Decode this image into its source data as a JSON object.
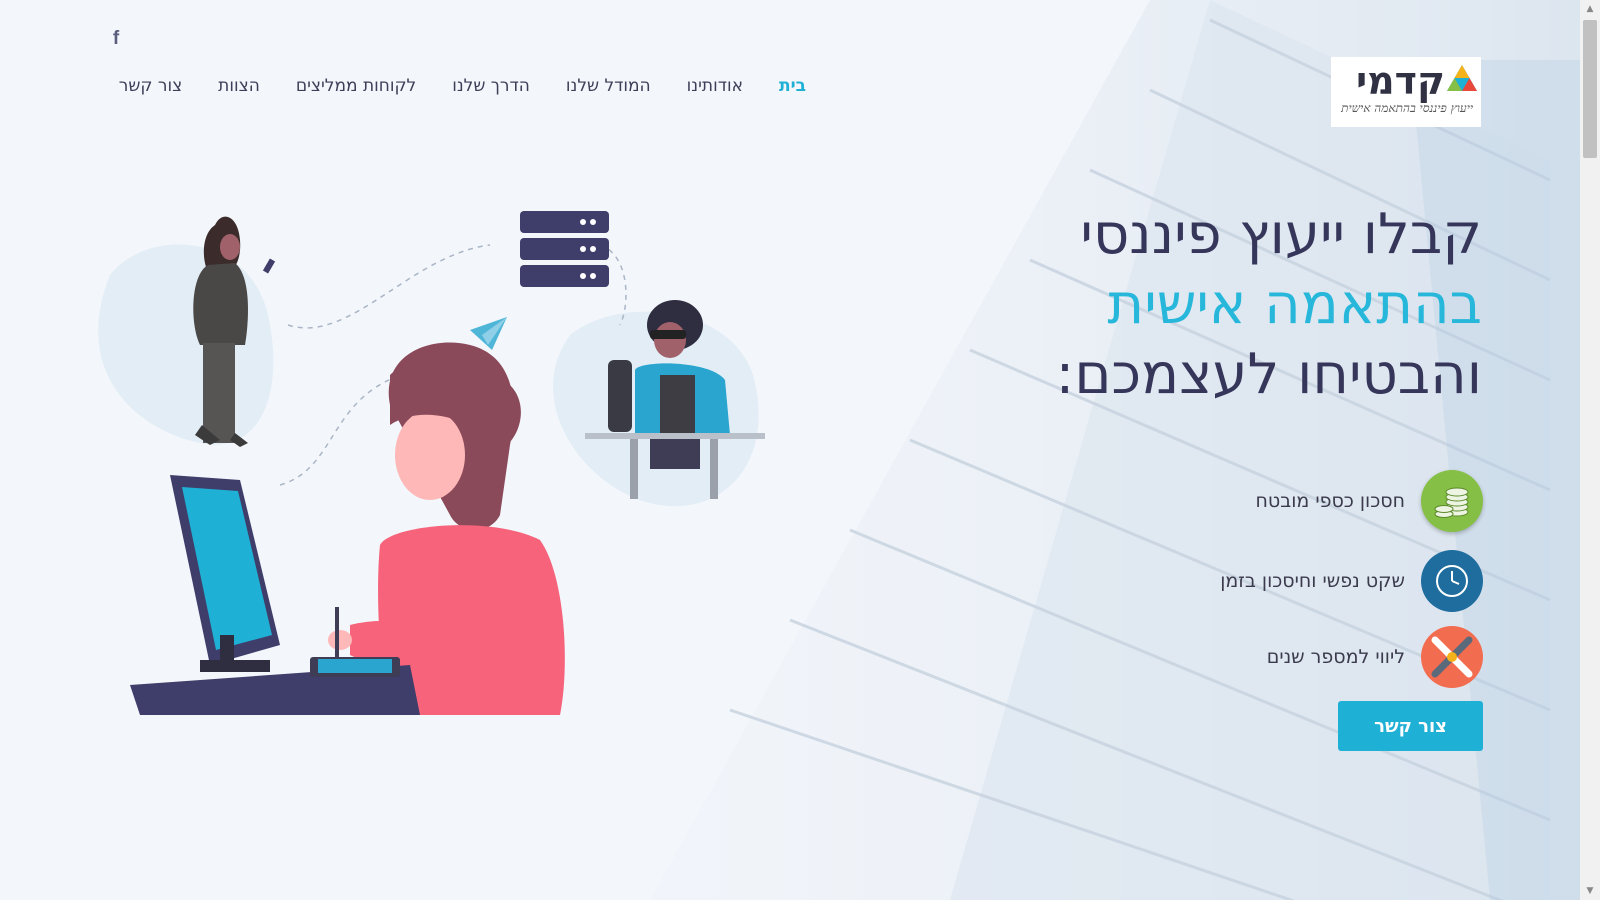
{
  "social": {
    "facebook_icon": "facebook-icon",
    "facebook_glyph": "f"
  },
  "nav": {
    "items": [
      {
        "label": "בית",
        "active": true
      },
      {
        "label": "אודותינו"
      },
      {
        "label": "המודל שלנו"
      },
      {
        "label": "הדרך שלנו"
      },
      {
        "label": "לקוחות ממליצים"
      },
      {
        "label": "הצוות"
      },
      {
        "label": "צור קשר"
      }
    ]
  },
  "logo": {
    "name": "קדמי",
    "tagline": "ייעוץ פיננסי בהתאמה אישית"
  },
  "hero": {
    "line1": "קבלו ייעוץ פיננסי",
    "line2": "בהתאמה אישית",
    "line3": "והבטיחו לעצמכם:"
  },
  "features": [
    {
      "label": "חסכון כספי מובטח",
      "icon": "coins-icon"
    },
    {
      "label": "שקט נפשי וחיסכון בזמן",
      "icon": "clock-icon"
    },
    {
      "label": "ליווי למספר שנים",
      "icon": "handshake-icon"
    }
  ],
  "cta": {
    "label": "צור קשר"
  },
  "colors": {
    "accent": "#1fb0d6",
    "heading": "#35365a",
    "background": "#f3f6fb"
  },
  "scrollbar": {
    "up": "▲",
    "down": "▼"
  }
}
